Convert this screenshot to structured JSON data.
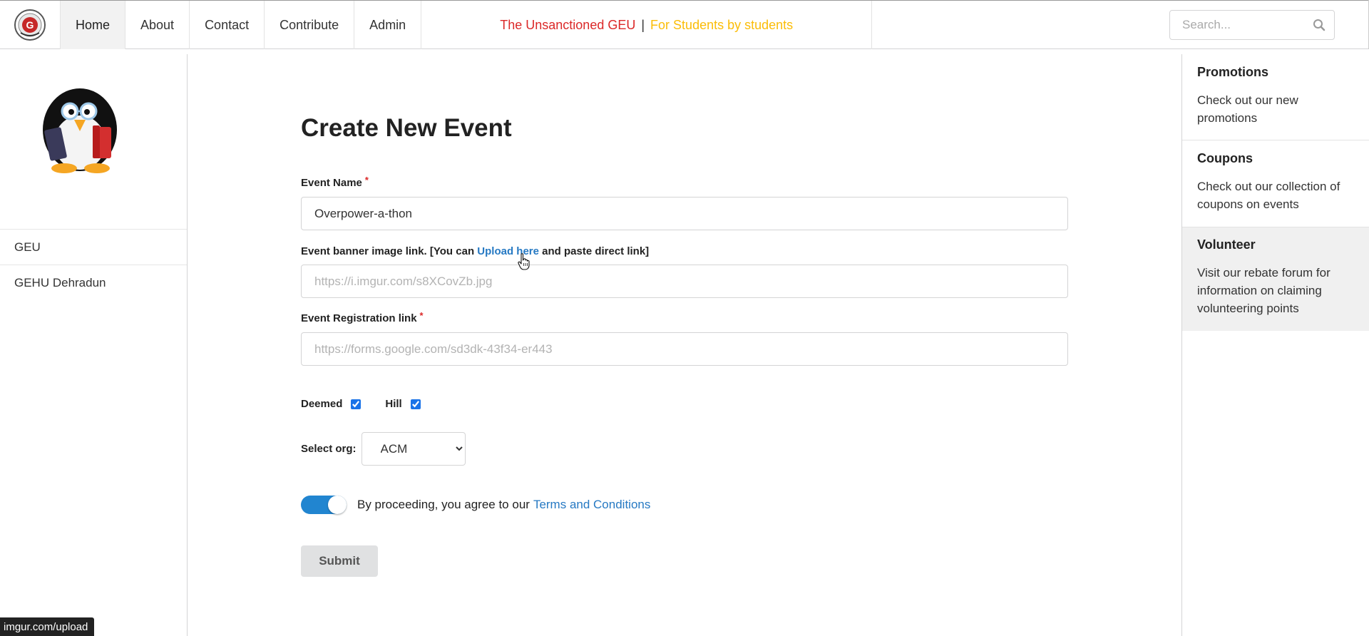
{
  "nav": {
    "items": [
      {
        "label": "Home",
        "active": true
      },
      {
        "label": "About",
        "active": false
      },
      {
        "label": "Contact",
        "active": false
      },
      {
        "label": "Contribute",
        "active": false
      },
      {
        "label": "Admin",
        "active": false
      }
    ],
    "tagline": {
      "primary": "The Unsanctioned GEU",
      "separator": "|",
      "secondary": "For Students by students"
    },
    "search_placeholder": "Search...",
    "logo_icon": "university-crest-logo"
  },
  "left_sidebar": {
    "mascot_icon": "penguin-mascot-icon",
    "links": [
      "GEU",
      "GEHU Dehradun"
    ]
  },
  "form": {
    "title": "Create New Event",
    "event_name": {
      "label": "Event Name",
      "required_mark": "*",
      "value": "Overpower-a-thon"
    },
    "banner": {
      "label_before": "Event banner image link. [You can ",
      "link_text": "Upload here",
      "label_after": " and paste direct link]",
      "placeholder": "https://i.imgur.com/s8XCovZb.jpg"
    },
    "registration": {
      "label": "Event Registration link",
      "required_mark": "*",
      "placeholder": "https://forms.google.com/sd3dk-43f34-er443"
    },
    "checkboxes": [
      {
        "label": "Deemed",
        "checked": true
      },
      {
        "label": "Hill",
        "checked": true
      }
    ],
    "org": {
      "label": "Select org:",
      "selected": "ACM"
    },
    "terms": {
      "text": "By proceeding, you agree to our",
      "link_text": "Terms and Conditions",
      "enabled": true
    },
    "submit_label": "Submit"
  },
  "right_sidebar": {
    "cards": [
      {
        "title": "Promotions",
        "body": "Check out our new promotions",
        "highlighted": false
      },
      {
        "title": "Coupons",
        "body": "Check out our collection of coupons on events",
        "highlighted": false
      },
      {
        "title": "Volunteer",
        "body": "Visit our rebate forum for information on claiming volunteering points",
        "highlighted": true
      }
    ]
  },
  "status_bar": {
    "url": "imgur.com/upload"
  },
  "colors": {
    "accent": "#2185d0",
    "link": "#2679c3",
    "tagline_red": "#db2828",
    "tagline_yellow": "#fbbd08",
    "required": "#db2828"
  }
}
